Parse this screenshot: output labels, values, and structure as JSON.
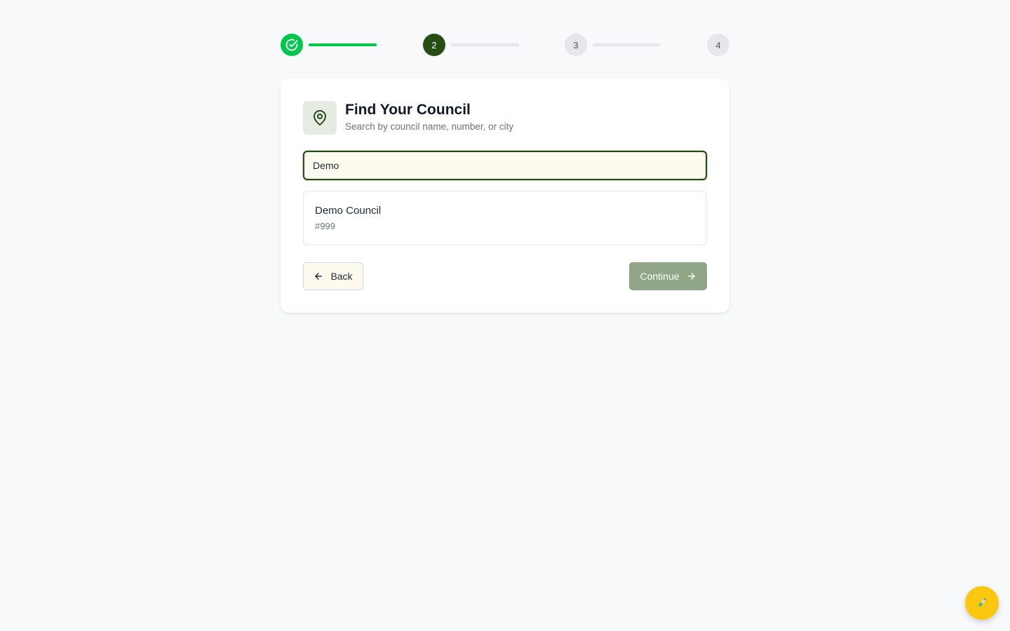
{
  "stepper": {
    "steps": [
      {
        "label": "",
        "state": "completed"
      },
      {
        "label": "2",
        "state": "current"
      },
      {
        "label": "3",
        "state": "upcoming"
      },
      {
        "label": "4",
        "state": "upcoming"
      }
    ],
    "completed_color": "#00c64b",
    "current_color": "#254d14"
  },
  "card": {
    "icon": "map-pin-icon",
    "title": "Find Your Council",
    "subtitle": "Search by council name, number, or city"
  },
  "search": {
    "value": "Demo"
  },
  "results": [
    {
      "name": "Demo Council",
      "number": "#999"
    }
  ],
  "actions": {
    "back_label": "Back",
    "continue_label": "Continue",
    "continue_enabled": false
  },
  "fab": {
    "icon": "test-tube-icon",
    "color": "#fcc80f"
  }
}
